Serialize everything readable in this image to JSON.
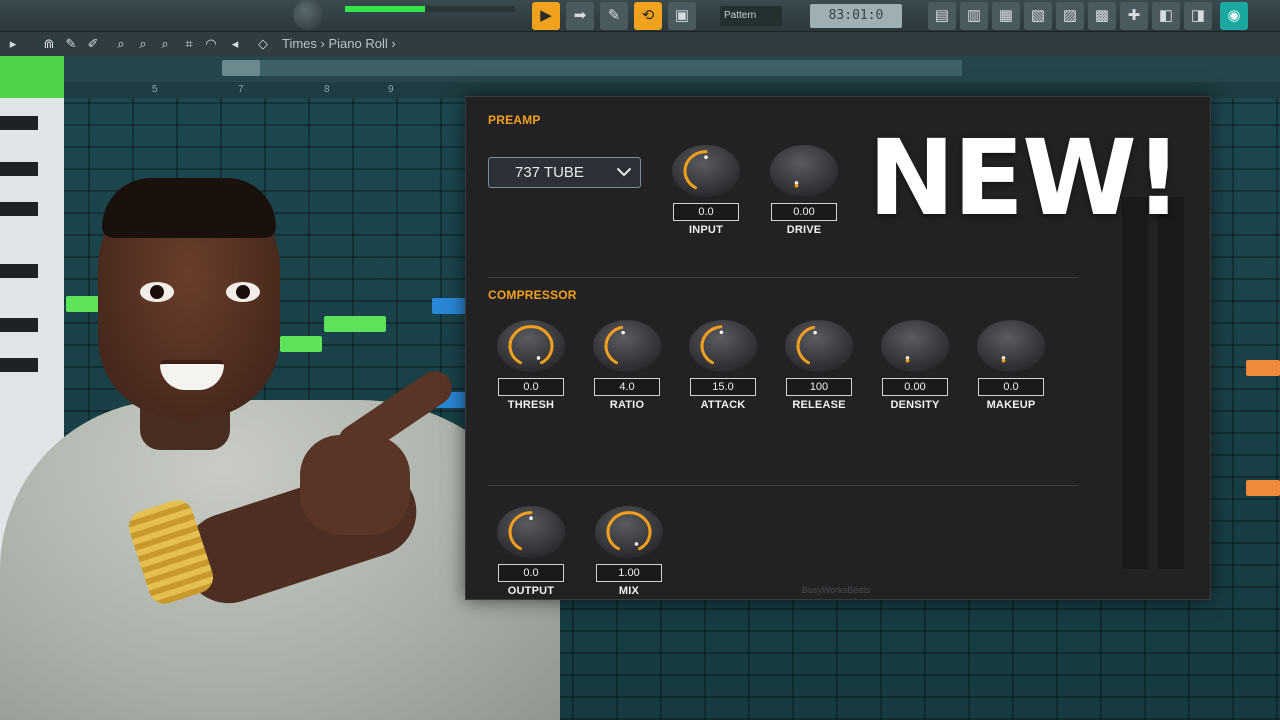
{
  "daw": {
    "tempo": "83:01:0",
    "pattern": "Pattern",
    "breadcrumb": "Piano Roll",
    "view_label": "Times",
    "ruler_numbers": [
      "5",
      "7",
      "8",
      "9"
    ]
  },
  "plugin": {
    "preamp": {
      "section_label": "PREAMP",
      "preset": "737 TUBE",
      "knobs": [
        {
          "label": "INPUT",
          "value": "0.0"
        },
        {
          "label": "DRIVE",
          "value": "0.00"
        }
      ]
    },
    "compressor": {
      "section_label": "COMPRESSOR",
      "knobs": [
        {
          "label": "THRESH",
          "value": "0.0"
        },
        {
          "label": "RATIO",
          "value": "4.0"
        },
        {
          "label": "ATTACK",
          "value": "15.0"
        },
        {
          "label": "RELEASE",
          "value": "100"
        },
        {
          "label": "DENSITY",
          "value": "0.00"
        },
        {
          "label": "MAKEUP",
          "value": "0.0"
        }
      ]
    },
    "output": {
      "knobs": [
        {
          "label": "OUTPUT",
          "value": "0.0"
        },
        {
          "label": "MIX",
          "value": "1.00"
        }
      ]
    },
    "brand": "BusyWorksBeats"
  },
  "overlay": {
    "headline": "NEW!"
  },
  "colors": {
    "accent": "#f4a01e",
    "plugin_bg": "#222225",
    "daw_grid": "#1d4a52",
    "note_green": "#5ee25a",
    "note_blue": "#2a86d6"
  },
  "icons": [
    "play-icon",
    "cursor-icon",
    "pencil-icon",
    "magnet-icon",
    "stamp-icon",
    "zoom-icon",
    "speaker-icon",
    "chevron-down-icon"
  ]
}
